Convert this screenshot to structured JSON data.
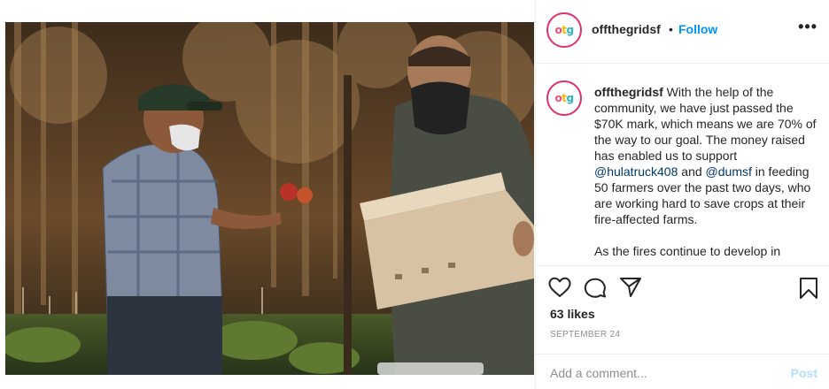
{
  "post": {
    "author": {
      "username": "offthegridsf",
      "avatar_text": [
        "o",
        "t",
        "g"
      ]
    },
    "header": {
      "separator": "•",
      "follow_label": "Follow",
      "more_label": "•••"
    },
    "caption": {
      "username": "offthegridsf",
      "part1": " With the help of the community, we have just passed the $70K mark, which means we are 70% of the way to our goal. The money raised has enabled us to support ",
      "mention1": "@hulatruck408",
      "part2": " and ",
      "mention2": "@dumsf",
      "part3": " in feeding 50 farmers over the past two days, who are working hard to save crops at their fire-affected farms.",
      "paragraph2": "As the fires continue to develop in"
    },
    "actions": {
      "likes": "63 likes",
      "date": "SEPTEMBER 24"
    },
    "comment": {
      "placeholder": "Add a comment...",
      "post_label": "Post"
    }
  },
  "colors": {
    "follow_blue": "#0095f6",
    "post_disabled": "#b2dffc",
    "mention": "#00376b",
    "muted": "#8e8e8e",
    "story_ring": "#e1306c"
  },
  "icons": [
    "heart-icon",
    "comment-icon",
    "paper-plane-icon",
    "bookmark-icon",
    "more-icon"
  ]
}
